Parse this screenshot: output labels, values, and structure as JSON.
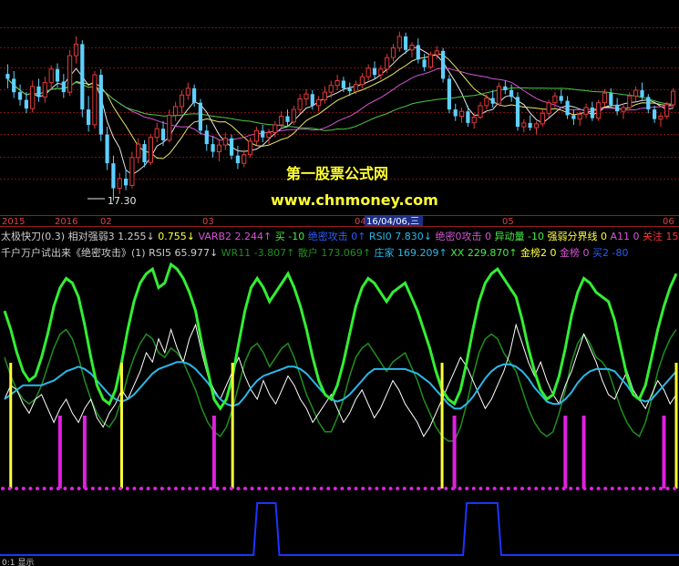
{
  "colors": {
    "background": "#000000",
    "grid": "#7a1010",
    "up_candle": "#e23a3a",
    "down_candle": "#5fd0ff",
    "ma_white": "#e8e8e8",
    "ma_yellow": "#e8e86a",
    "ma_magenta": "#d455d4",
    "ma_green": "#4ac84a",
    "watermark_title": "#ffff33",
    "watermark_url": "#ffff33",
    "bright_green": "#33ee33",
    "dark_green": "#1f8f1f",
    "cyan": "#2ab8e8",
    "white": "#ffffff",
    "signal_yellow": "#ffff33",
    "signal_magenta": "#e020e0",
    "dots_magenta": "#e020e0",
    "blue_line": "#1c34ff"
  },
  "watermark": {
    "title": "第一股票公式网",
    "url": "www.chnmoney.com"
  },
  "price_panel": {
    "low_label": "17.30"
  },
  "time_axis": {
    "labels": [
      "2015",
      "2016",
      "02",
      "03",
      "04",
      "05",
      "06"
    ],
    "highlight_label": "16/04/06,三"
  },
  "indicator_row1": [
    {
      "text": "太极快刀(0.3)",
      "color": "#cccccc"
    },
    {
      "text": "相对强弱3 1.255↓",
      "color": "#cccccc"
    },
    {
      "text": "0.755↓",
      "color": "#ffff44"
    },
    {
      "text": "VARB2 2.244↑",
      "color": "#d455d4"
    },
    {
      "text": "买 -10",
      "color": "#44ee44"
    },
    {
      "text": "绝密攻击 0↑",
      "color": "#2a5cff"
    },
    {
      "text": "RSI0 7.830↓",
      "color": "#2ab8e8"
    },
    {
      "text": "绝密0攻击 0",
      "color": "#d455d4"
    },
    {
      "text": "异动量 -10",
      "color": "#44ee44"
    },
    {
      "text": "强弱分界线 0",
      "color": "#ffff44"
    },
    {
      "text": "A11 0",
      "color": "#d455d4"
    },
    {
      "text": "关注 15",
      "color": "#ff3333"
    }
  ],
  "indicator_row2": [
    {
      "text": "千户万户试出来《绝密攻击》(1)",
      "color": "#cccccc"
    },
    {
      "text": "RSI5 65.977↓",
      "color": "#cccccc"
    },
    {
      "text": "WR11 -3.807↑",
      "color": "#1f8f1f"
    },
    {
      "text": "散户 173.069↑",
      "color": "#1f8f1f"
    },
    {
      "text": "庄家 169.209↑",
      "color": "#2ab8e8"
    },
    {
      "text": "XX 229.870↑",
      "color": "#44ee44"
    },
    {
      "text": "金榜2 0",
      "color": "#ffff44"
    },
    {
      "text": "金榜 0",
      "color": "#d455d4"
    },
    {
      "text": "买2 -80",
      "color": "#2a5cff"
    }
  ],
  "bottom_label": "0:1 显示",
  "chart_data": [
    {
      "type": "candlestick",
      "title": "",
      "axis": "price",
      "annotations": [
        "17.30"
      ],
      "ohlc": [
        [
          30.5,
          31.5,
          29.0,
          30.0
        ],
        [
          30.0,
          30.8,
          28.0,
          28.6
        ],
        [
          28.6,
          29.4,
          27.2,
          27.8
        ],
        [
          27.8,
          28.6,
          26.4,
          26.9
        ],
        [
          26.9,
          29.8,
          26.5,
          29.2
        ],
        [
          29.2,
          30.0,
          27.6,
          28.1
        ],
        [
          28.1,
          30.2,
          27.5,
          29.6
        ],
        [
          29.6,
          31.4,
          28.9,
          31.0
        ],
        [
          31.0,
          31.6,
          29.1,
          29.7
        ],
        [
          29.7,
          30.5,
          28.0,
          28.6
        ],
        [
          28.6,
          33.0,
          28.2,
          32.4
        ],
        [
          32.4,
          34.4,
          31.6,
          33.6
        ],
        [
          33.6,
          34.0,
          26.0,
          26.8
        ],
        [
          26.8,
          28.2,
          24.5,
          25.2
        ],
        [
          25.2,
          30.8,
          24.8,
          30.4
        ],
        [
          30.4,
          31.0,
          23.5,
          24.2
        ],
        [
          24.2,
          25.0,
          20.5,
          21.2
        ],
        [
          21.2,
          22.0,
          17.3,
          18.6
        ],
        [
          18.6,
          20.2,
          18.0,
          19.6
        ],
        [
          19.6,
          20.6,
          18.4,
          18.9
        ],
        [
          18.9,
          22.4,
          18.6,
          21.8
        ],
        [
          21.8,
          23.8,
          21.2,
          23.2
        ],
        [
          23.2,
          23.6,
          20.8,
          21.3
        ],
        [
          21.3,
          24.2,
          21.0,
          23.9
        ],
        [
          23.9,
          25.4,
          23.4,
          24.8
        ],
        [
          24.8,
          25.6,
          23.0,
          23.6
        ],
        [
          23.6,
          26.8,
          23.4,
          26.2
        ],
        [
          26.2,
          27.6,
          25.6,
          27.1
        ],
        [
          27.1,
          28.8,
          26.4,
          28.3
        ],
        [
          28.3,
          29.6,
          27.8,
          29.0
        ],
        [
          29.0,
          29.4,
          27.1,
          27.5
        ],
        [
          27.5,
          27.9,
          24.2,
          24.6
        ],
        [
          24.6,
          25.2,
          22.5,
          23.2
        ],
        [
          23.2,
          24.0,
          21.8,
          22.4
        ],
        [
          22.4,
          23.6,
          21.4,
          23.1
        ],
        [
          23.1,
          24.4,
          22.6,
          23.8
        ],
        [
          23.8,
          24.2,
          21.6,
          22.0
        ],
        [
          22.0,
          23.0,
          20.6,
          21.2
        ],
        [
          21.2,
          22.6,
          20.8,
          22.1
        ],
        [
          22.1,
          23.9,
          21.8,
          23.5
        ],
        [
          23.5,
          25.0,
          23.1,
          24.6
        ],
        [
          24.6,
          25.2,
          23.4,
          23.9
        ],
        [
          23.9,
          24.8,
          23.2,
          24.4
        ],
        [
          24.4,
          25.6,
          23.9,
          25.2
        ],
        [
          25.2,
          26.6,
          24.8,
          26.1
        ],
        [
          26.1,
          26.8,
          25.0,
          25.5
        ],
        [
          25.5,
          27.2,
          25.2,
          26.8
        ],
        [
          26.8,
          28.4,
          26.4,
          27.9
        ],
        [
          27.9,
          28.9,
          27.2,
          28.4
        ],
        [
          28.4,
          28.8,
          26.8,
          27.2
        ],
        [
          27.2,
          28.2,
          26.6,
          27.8
        ],
        [
          27.8,
          29.2,
          27.4,
          28.6
        ],
        [
          28.6,
          29.8,
          28.0,
          29.3
        ],
        [
          29.3,
          30.4,
          28.8,
          29.8
        ],
        [
          29.8,
          30.2,
          28.6,
          29.0
        ],
        [
          29.0,
          29.6,
          28.2,
          28.7
        ],
        [
          28.7,
          29.8,
          28.4,
          29.4
        ],
        [
          29.4,
          30.6,
          29.0,
          30.2
        ],
        [
          30.2,
          31.5,
          29.8,
          31.1
        ],
        [
          31.1,
          31.8,
          30.0,
          30.4
        ],
        [
          30.4,
          31.4,
          29.9,
          31.0
        ],
        [
          31.0,
          32.6,
          30.6,
          32.2
        ],
        [
          32.2,
          33.6,
          31.8,
          33.2
        ],
        [
          33.2,
          34.9,
          32.8,
          34.4
        ],
        [
          34.4,
          34.8,
          32.6,
          33.0
        ],
        [
          33.0,
          33.8,
          32.2,
          33.5
        ],
        [
          33.5,
          34.2,
          31.6,
          32.0
        ],
        [
          32.0,
          32.6,
          30.8,
          31.2
        ],
        [
          31.2,
          32.8,
          31.0,
          32.5
        ],
        [
          32.5,
          33.4,
          32.0,
          32.9
        ],
        [
          32.9,
          33.2,
          29.6,
          30.0
        ],
        [
          30.0,
          30.4,
          26.4,
          26.8
        ],
        [
          26.8,
          27.4,
          25.6,
          26.1
        ],
        [
          26.1,
          27.0,
          25.4,
          26.6
        ],
        [
          26.6,
          27.2,
          25.0,
          25.4
        ],
        [
          25.4,
          26.4,
          24.8,
          26.0
        ],
        [
          26.0,
          27.6,
          25.8,
          27.2
        ],
        [
          27.2,
          28.4,
          26.8,
          28.0
        ],
        [
          28.0,
          28.8,
          27.0,
          27.4
        ],
        [
          27.4,
          29.6,
          27.2,
          29.2
        ],
        [
          29.2,
          29.8,
          28.4,
          28.8
        ],
        [
          28.8,
          29.4,
          27.6,
          28.1
        ],
        [
          28.1,
          28.6,
          24.6,
          25.0
        ],
        [
          25.0,
          25.8,
          24.4,
          25.4
        ],
        [
          25.4,
          26.2,
          24.6,
          24.9
        ],
        [
          24.9,
          25.6,
          24.2,
          25.3
        ],
        [
          25.3,
          26.8,
          25.0,
          26.4
        ],
        [
          26.4,
          27.8,
          26.0,
          27.5
        ],
        [
          27.5,
          28.6,
          27.0,
          28.2
        ],
        [
          28.2,
          28.9,
          27.4,
          27.7
        ],
        [
          27.7,
          28.2,
          25.8,
          26.2
        ],
        [
          26.2,
          26.8,
          25.2,
          25.8
        ],
        [
          25.8,
          26.6,
          25.1,
          26.3
        ],
        [
          26.3,
          27.4,
          25.9,
          27.0
        ],
        [
          27.0,
          27.6,
          25.6,
          25.9
        ],
        [
          25.9,
          27.8,
          25.6,
          27.5
        ],
        [
          27.5,
          28.9,
          27.1,
          28.5
        ],
        [
          28.5,
          29.0,
          27.0,
          27.3
        ],
        [
          27.3,
          28.0,
          26.2,
          26.6
        ],
        [
          26.6,
          27.4,
          25.8,
          27.0
        ],
        [
          27.0,
          28.6,
          26.8,
          28.2
        ],
        [
          28.2,
          29.2,
          27.6,
          28.8
        ],
        [
          28.8,
          29.6,
          27.8,
          28.1
        ],
        [
          28.1,
          28.4,
          26.4,
          26.8
        ],
        [
          26.8,
          27.2,
          25.4,
          25.8
        ],
        [
          25.8,
          26.4,
          25.0,
          26.1
        ],
        [
          26.1,
          27.6,
          25.8,
          27.3
        ],
        [
          27.3,
          29.0,
          27.0,
          28.7
        ]
      ]
    },
    {
      "type": "line",
      "title": "",
      "axis": "oscillator",
      "series_desc": [
        "bright green",
        "dark green",
        "cyan",
        "white"
      ],
      "bright_green": [
        78,
        70,
        60,
        52,
        48,
        50,
        58,
        68,
        80,
        88,
        92,
        90,
        84,
        72,
        58,
        46,
        40,
        38,
        44,
        56,
        70,
        82,
        90,
        94,
        96,
        88,
        90,
        98,
        96,
        92,
        86,
        78,
        64,
        52,
        40,
        36,
        40,
        50,
        64,
        78,
        88,
        92,
        88,
        82,
        86,
        90,
        94,
        88,
        80,
        70,
        58,
        48,
        42,
        40,
        46,
        56,
        68,
        80,
        88,
        92,
        90,
        86,
        82,
        86,
        88,
        90,
        84,
        78,
        70,
        62,
        52,
        44,
        40,
        38,
        44,
        56,
        70,
        82,
        90,
        94,
        96,
        92,
        88,
        84,
        74,
        62,
        52,
        44,
        40,
        42,
        50,
        62,
        76,
        86,
        92,
        90,
        86,
        84,
        82,
        74,
        62,
        50,
        42,
        40,
        46,
        58,
        70,
        80,
        88,
        94
      ],
      "dark_green": [
        58,
        50,
        44,
        40,
        38,
        40,
        46,
        54,
        62,
        68,
        70,
        66,
        58,
        48,
        40,
        34,
        30,
        28,
        32,
        40,
        50,
        58,
        64,
        68,
        66,
        60,
        58,
        62,
        60,
        56,
        50,
        44,
        36,
        30,
        26,
        24,
        28,
        36,
        46,
        56,
        62,
        64,
        60,
        54,
        58,
        62,
        64,
        58,
        50,
        42,
        36,
        30,
        26,
        26,
        32,
        40,
        50,
        58,
        62,
        64,
        60,
        56,
        52,
        56,
        58,
        60,
        54,
        48,
        40,
        34,
        28,
        24,
        22,
        22,
        28,
        38,
        50,
        60,
        66,
        68,
        66,
        60,
        56,
        52,
        44,
        36,
        30,
        26,
        24,
        26,
        34,
        44,
        56,
        64,
        68,
        64,
        58,
        56,
        52,
        44,
        36,
        30,
        26,
        24,
        30,
        40,
        52,
        60,
        66,
        70
      ],
      "cyan": [
        40,
        42,
        44,
        46,
        46,
        46,
        46,
        47,
        48,
        50,
        52,
        53,
        54,
        53,
        51,
        48,
        45,
        42,
        40,
        39,
        40,
        42,
        45,
        48,
        51,
        53,
        54,
        55,
        56,
        56,
        55,
        53,
        50,
        47,
        43,
        40,
        38,
        37,
        38,
        41,
        45,
        48,
        50,
        51,
        52,
        53,
        54,
        54,
        53,
        51,
        48,
        45,
        42,
        40,
        39,
        40,
        42,
        45,
        48,
        51,
        53,
        53,
        53,
        53,
        53,
        53,
        52,
        51,
        49,
        47,
        44,
        41,
        38,
        36,
        36,
        38,
        41,
        45,
        49,
        52,
        54,
        55,
        55,
        54,
        52,
        49,
        45,
        42,
        39,
        38,
        38,
        40,
        43,
        47,
        50,
        52,
        53,
        53,
        53,
        52,
        49,
        46,
        42,
        40,
        39,
        40,
        43,
        46,
        49,
        52
      ],
      "white": [
        40,
        46,
        44,
        38,
        34,
        40,
        42,
        36,
        30,
        36,
        40,
        34,
        30,
        36,
        40,
        32,
        28,
        34,
        38,
        44,
        40,
        46,
        52,
        60,
        56,
        66,
        60,
        70,
        62,
        56,
        66,
        72,
        60,
        50,
        44,
        40,
        46,
        52,
        58,
        50,
        44,
        40,
        48,
        42,
        38,
        44,
        50,
        46,
        40,
        36,
        30,
        34,
        38,
        42,
        36,
        30,
        34,
        40,
        44,
        38,
        32,
        36,
        42,
        48,
        44,
        38,
        34,
        30,
        24,
        28,
        34,
        40,
        46,
        52,
        58,
        54,
        48,
        42,
        36,
        40,
        46,
        52,
        60,
        72,
        64,
        56,
        50,
        56,
        48,
        42,
        38,
        46,
        52,
        60,
        68,
        62,
        56,
        48,
        42,
        40,
        46,
        52,
        44,
        40,
        36,
        42,
        48,
        44,
        38,
        42
      ],
      "yellow_signals_at": [
        1,
        19,
        37,
        71,
        111
      ],
      "magenta_signals_at": [
        9,
        13,
        34,
        73,
        91,
        94,
        107
      ]
    },
    {
      "type": "line",
      "title": "",
      "axis": "binary",
      "blue_pulses": [
        [
          41,
          44
        ],
        [
          75,
          80
        ]
      ]
    }
  ]
}
